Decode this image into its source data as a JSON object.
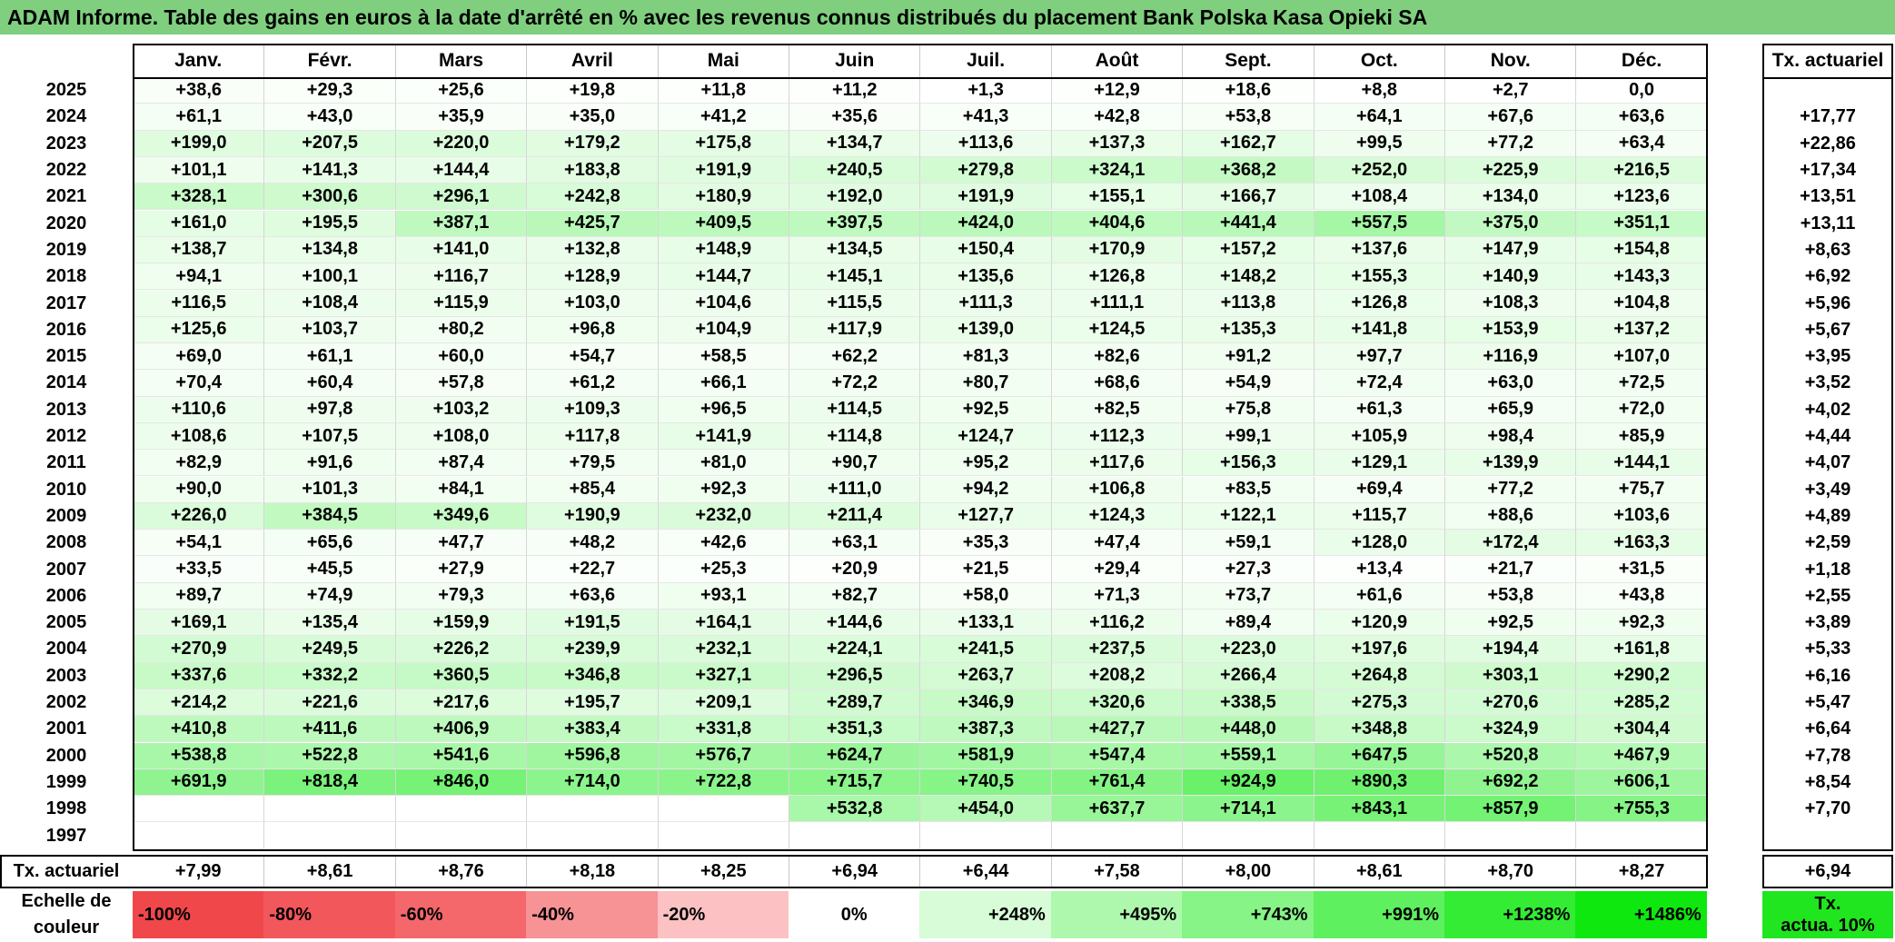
{
  "title": "ADAM Informe. Table des gains en euros à la date d'arrêté en % avec les revenus connus distribués du placement Bank Polska Kasa Opieki SA",
  "chart_data": {
    "type": "heatmap",
    "title": "ADAM Informe. Table des gains en euros à la date d'arrêté en % avec les revenus connus distribués du placement Bank Polska Kasa Opieki SA",
    "columns": [
      "Janv.",
      "Févr.",
      "Mars",
      "Avril",
      "Mai",
      "Juin",
      "Juil.",
      "Août",
      "Sept.",
      "Oct.",
      "Nov.",
      "Déc."
    ],
    "rate_header": "Tx. actuariel",
    "rows": [
      {
        "year": "2025",
        "values": [
          "+38,6",
          "+29,3",
          "+25,6",
          "+19,8",
          "+11,8",
          "+11,2",
          "+1,3",
          "+12,9",
          "+18,6",
          "+8,8",
          "+2,7",
          "0,0"
        ],
        "rate": ""
      },
      {
        "year": "2024",
        "values": [
          "+61,1",
          "+43,0",
          "+35,9",
          "+35,0",
          "+41,2",
          "+35,6",
          "+41,3",
          "+42,8",
          "+53,8",
          "+64,1",
          "+67,6",
          "+63,6"
        ],
        "rate": "+17,77"
      },
      {
        "year": "2023",
        "values": [
          "+199,0",
          "+207,5",
          "+220,0",
          "+179,2",
          "+175,8",
          "+134,7",
          "+113,6",
          "+137,3",
          "+162,7",
          "+99,5",
          "+77,2",
          "+63,4"
        ],
        "rate": "+22,86"
      },
      {
        "year": "2022",
        "values": [
          "+101,1",
          "+141,3",
          "+144,4",
          "+183,8",
          "+191,9",
          "+240,5",
          "+279,8",
          "+324,1",
          "+368,2",
          "+252,0",
          "+225,9",
          "+216,5"
        ],
        "rate": "+17,34"
      },
      {
        "year": "2021",
        "values": [
          "+328,1",
          "+300,6",
          "+296,1",
          "+242,8",
          "+180,9",
          "+192,0",
          "+191,9",
          "+155,1",
          "+166,7",
          "+108,4",
          "+134,0",
          "+123,6"
        ],
        "rate": "+13,51"
      },
      {
        "year": "2020",
        "values": [
          "+161,0",
          "+195,5",
          "+387,1",
          "+425,7",
          "+409,5",
          "+397,5",
          "+424,0",
          "+404,6",
          "+441,4",
          "+557,5",
          "+375,0",
          "+351,1"
        ],
        "rate": "+13,11"
      },
      {
        "year": "2019",
        "values": [
          "+138,7",
          "+134,8",
          "+141,0",
          "+132,8",
          "+148,9",
          "+134,5",
          "+150,4",
          "+170,9",
          "+157,2",
          "+137,6",
          "+147,9",
          "+154,8"
        ],
        "rate": "+8,63"
      },
      {
        "year": "2018",
        "values": [
          "+94,1",
          "+100,1",
          "+116,7",
          "+128,9",
          "+144,7",
          "+145,1",
          "+135,6",
          "+126,8",
          "+148,2",
          "+155,3",
          "+140,9",
          "+143,3"
        ],
        "rate": "+6,92"
      },
      {
        "year": "2017",
        "values": [
          "+116,5",
          "+108,4",
          "+115,9",
          "+103,0",
          "+104,6",
          "+115,5",
          "+111,3",
          "+111,1",
          "+113,8",
          "+126,8",
          "+108,3",
          "+104,8"
        ],
        "rate": "+5,96"
      },
      {
        "year": "2016",
        "values": [
          "+125,6",
          "+103,7",
          "+80,2",
          "+96,8",
          "+104,9",
          "+117,9",
          "+139,0",
          "+124,5",
          "+135,3",
          "+141,8",
          "+153,9",
          "+137,2"
        ],
        "rate": "+5,67"
      },
      {
        "year": "2015",
        "values": [
          "+69,0",
          "+61,1",
          "+60,0",
          "+54,7",
          "+58,5",
          "+62,2",
          "+81,3",
          "+82,6",
          "+91,2",
          "+97,7",
          "+116,9",
          "+107,0"
        ],
        "rate": "+3,95"
      },
      {
        "year": "2014",
        "values": [
          "+70,4",
          "+60,4",
          "+57,8",
          "+61,2",
          "+66,1",
          "+72,2",
          "+80,7",
          "+68,6",
          "+54,9",
          "+72,4",
          "+63,0",
          "+72,5"
        ],
        "rate": "+3,52"
      },
      {
        "year": "2013",
        "values": [
          "+110,6",
          "+97,8",
          "+103,2",
          "+109,3",
          "+96,5",
          "+114,5",
          "+92,5",
          "+82,5",
          "+75,8",
          "+61,3",
          "+65,9",
          "+72,0"
        ],
        "rate": "+4,02"
      },
      {
        "year": "2012",
        "values": [
          "+108,6",
          "+107,5",
          "+108,0",
          "+117,8",
          "+141,9",
          "+114,8",
          "+124,7",
          "+112,3",
          "+99,1",
          "+105,9",
          "+98,4",
          "+85,9"
        ],
        "rate": "+4,44"
      },
      {
        "year": "2011",
        "values": [
          "+82,9",
          "+91,6",
          "+87,4",
          "+79,5",
          "+81,0",
          "+90,7",
          "+95,2",
          "+117,6",
          "+156,3",
          "+129,1",
          "+139,9",
          "+144,1"
        ],
        "rate": "+4,07"
      },
      {
        "year": "2010",
        "values": [
          "+90,0",
          "+101,3",
          "+84,1",
          "+85,4",
          "+92,3",
          "+111,0",
          "+94,2",
          "+106,8",
          "+83,5",
          "+69,4",
          "+77,2",
          "+75,7"
        ],
        "rate": "+3,49"
      },
      {
        "year": "2009",
        "values": [
          "+226,0",
          "+384,5",
          "+349,6",
          "+190,9",
          "+232,0",
          "+211,4",
          "+127,7",
          "+124,3",
          "+122,1",
          "+115,7",
          "+88,6",
          "+103,6"
        ],
        "rate": "+4,89"
      },
      {
        "year": "2008",
        "values": [
          "+54,1",
          "+65,6",
          "+47,7",
          "+48,2",
          "+42,6",
          "+63,1",
          "+35,3",
          "+47,4",
          "+59,1",
          "+128,0",
          "+172,4",
          "+163,3"
        ],
        "rate": "+2,59"
      },
      {
        "year": "2007",
        "values": [
          "+33,5",
          "+45,5",
          "+27,9",
          "+22,7",
          "+25,3",
          "+20,9",
          "+21,5",
          "+29,4",
          "+27,3",
          "+13,4",
          "+21,7",
          "+31,5"
        ],
        "rate": "+1,18"
      },
      {
        "year": "2006",
        "values": [
          "+89,7",
          "+74,9",
          "+79,3",
          "+63,6",
          "+93,1",
          "+82,7",
          "+58,0",
          "+71,3",
          "+73,7",
          "+61,6",
          "+53,8",
          "+43,8"
        ],
        "rate": "+2,55"
      },
      {
        "year": "2005",
        "values": [
          "+169,1",
          "+135,4",
          "+159,9",
          "+191,5",
          "+164,1",
          "+144,6",
          "+133,1",
          "+116,2",
          "+89,4",
          "+120,9",
          "+92,5",
          "+92,3"
        ],
        "rate": "+3,89"
      },
      {
        "year": "2004",
        "values": [
          "+270,9",
          "+249,5",
          "+226,2",
          "+239,9",
          "+232,1",
          "+224,1",
          "+241,5",
          "+237,5",
          "+223,0",
          "+197,6",
          "+194,4",
          "+161,8"
        ],
        "rate": "+5,33"
      },
      {
        "year": "2003",
        "values": [
          "+337,6",
          "+332,2",
          "+360,5",
          "+346,8",
          "+327,1",
          "+296,5",
          "+263,7",
          "+208,2",
          "+266,4",
          "+264,8",
          "+303,1",
          "+290,2"
        ],
        "rate": "+6,16"
      },
      {
        "year": "2002",
        "values": [
          "+214,2",
          "+221,6",
          "+217,6",
          "+195,7",
          "+209,1",
          "+289,7",
          "+346,9",
          "+320,6",
          "+338,5",
          "+275,3",
          "+270,6",
          "+285,2"
        ],
        "rate": "+5,47"
      },
      {
        "year": "2001",
        "values": [
          "+410,8",
          "+411,6",
          "+406,9",
          "+383,4",
          "+331,8",
          "+351,3",
          "+387,3",
          "+427,7",
          "+448,0",
          "+348,8",
          "+324,9",
          "+304,4"
        ],
        "rate": "+6,64"
      },
      {
        "year": "2000",
        "values": [
          "+538,8",
          "+522,8",
          "+541,6",
          "+596,8",
          "+576,7",
          "+624,7",
          "+581,9",
          "+547,4",
          "+559,1",
          "+647,5",
          "+520,8",
          "+467,9"
        ],
        "rate": "+7,78"
      },
      {
        "year": "1999",
        "values": [
          "+691,9",
          "+818,4",
          "+846,0",
          "+714,0",
          "+722,8",
          "+715,7",
          "+740,5",
          "+761,4",
          "+924,9",
          "+890,3",
          "+692,2",
          "+606,1"
        ],
        "rate": "+8,54"
      },
      {
        "year": "1998",
        "values": [
          "",
          "",
          "",
          "",
          "",
          "+532,8",
          "+454,0",
          "+637,7",
          "+714,1",
          "+843,1",
          "+857,9",
          "+755,3"
        ],
        "rate": "+7,70"
      },
      {
        "year": "1997",
        "values": [
          "",
          "",
          "",
          "",
          "",
          "",
          "",
          "",
          "",
          "",
          "",
          ""
        ],
        "rate": ""
      }
    ],
    "footer": {
      "label": "Tx. actuariel",
      "values": [
        "+7,99",
        "+8,61",
        "+8,76",
        "+8,18",
        "+8,25",
        "+6,94",
        "+6,44",
        "+7,58",
        "+8,00",
        "+8,61",
        "+8,70",
        "+8,27"
      ],
      "rate": "+6,94"
    },
    "legend": {
      "label_line1": "Echelle de",
      "label_line2": "couleur",
      "items": [
        {
          "label": "-100%",
          "color": "#f0474b"
        },
        {
          "label": "-80%",
          "color": "#f2575b"
        },
        {
          "label": "-60%",
          "color": "#f4676b"
        },
        {
          "label": "-40%",
          "color": "#f79295"
        },
        {
          "label": "-20%",
          "color": "#fbc1c3"
        },
        {
          "label": "0%",
          "color": "#ffffff"
        },
        {
          "label": "+248%",
          "color": "#d7fcd7"
        },
        {
          "label": "+495%",
          "color": "#aef8ae"
        },
        {
          "label": "+743%",
          "color": "#86f486"
        },
        {
          "label": "+991%",
          "color": "#5ef05e"
        },
        {
          "label": "+1238%",
          "color": "#34ec34"
        },
        {
          "label": "+1486%",
          "color": "#0fe80f"
        }
      ],
      "rate_label_line1": "Tx.",
      "rate_label_line2": "actua. 10%",
      "rate_color": "#1fe61f"
    }
  }
}
